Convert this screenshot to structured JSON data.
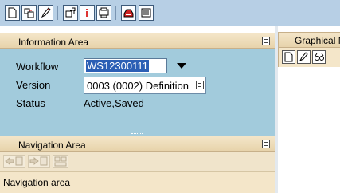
{
  "toolbar": {
    "buttons": [
      {
        "icon": "new-document-icon"
      },
      {
        "icon": "other-object-icon"
      },
      {
        "icon": "edit-pencil-icon"
      },
      {
        "icon": "generate-version-icon"
      },
      {
        "icon": "information-icon"
      },
      {
        "icon": "print-icon"
      },
      {
        "icon": "inbox-icon"
      },
      {
        "icon": "list-icon"
      }
    ]
  },
  "information_area": {
    "title": "Information Area",
    "fields": {
      "workflow_label": "Workflow",
      "workflow_value": "WS12300111",
      "version_label": "Version",
      "version_value": "0003 (0002) Definition",
      "status_label": "Status",
      "status_value": "Active,Saved"
    }
  },
  "navigation_area": {
    "title": "Navigation Area",
    "toolbar_icons": [
      "back-icon",
      "forward-icon",
      "structure-icon"
    ],
    "body_text": "Navigation area"
  },
  "graphical_area": {
    "title": "Graphical Model Editor",
    "toolbar_icons": [
      "new-document-icon",
      "edit-pencil-icon",
      "display-glasses-icon"
    ]
  },
  "colors": {
    "toolbar_bg": "#b7cfe5",
    "panel_header_bg": "#f4e6c9",
    "info_body_bg": "#a2cbdc",
    "selection": "#2b5fb5"
  }
}
